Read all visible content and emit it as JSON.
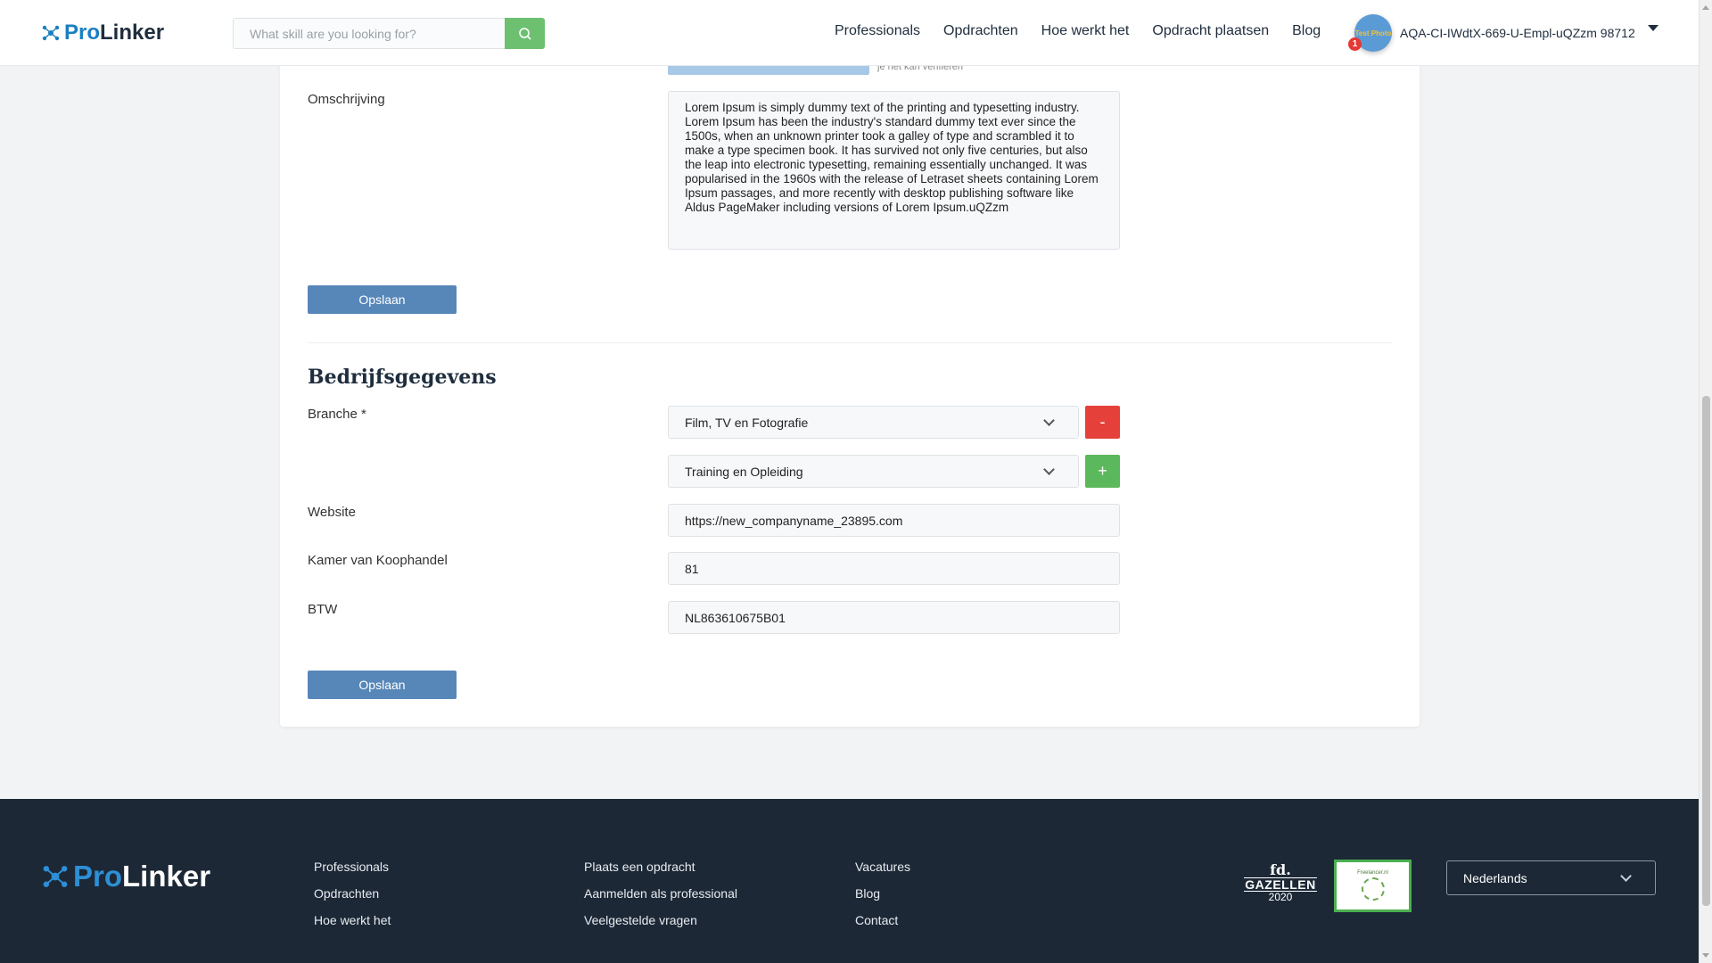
{
  "header": {
    "logo_pro": "Pro",
    "logo_linker": "Linker",
    "search_placeholder": "What skill are you looking for?",
    "nav": [
      "Professionals",
      "Opdrachten",
      "Hoe werkt het",
      "Opdracht plaatsen",
      "Blog"
    ],
    "user_name": "AQA-CI-IWdtX-669-U-Empl-uQZzm 98712",
    "notification_count": "1",
    "avatar_text": "Test Photo"
  },
  "profile": {
    "verify_note": "je het kan verifiëren",
    "description_label": "Omschrijving",
    "description_value": "Lorem Ipsum is simply dummy text of the printing and typesetting industry. Lorem Ipsum has been the industry's standard dummy text ever since the 1500s, when an unknown printer took a galley of type and scrambled it to make a type specimen book. It has survived not only five centuries, but also the leap into electronic typesetting, remaining essentially unchanged. It was popularised in the 1960s with the release of Letraset sheets containing Lorem Ipsum passages, and more recently with desktop publishing software like Aldus PageMaker including versions of Lorem Ipsum.uQZzm",
    "save_label": "Opslaan"
  },
  "company": {
    "title": "Bedrijfsgegevens",
    "branche_label": "Branche *",
    "branche_values": [
      "Film, TV en Fotografie",
      "Training en Opleiding"
    ],
    "remove_label": "-",
    "add_label": "+",
    "website_label": "Website",
    "website_value": "https://new_companyname_23895.com",
    "kvk_label": "Kamer van Koophandel",
    "kvk_value": "81",
    "btw_label": "BTW",
    "btw_value": "NL863610675B01",
    "save_label": "Opslaan"
  },
  "footer": {
    "logo_pro": "Pro",
    "logo_linker": "Linker",
    "col1": [
      "Professionals",
      "Opdrachten",
      "Hoe werkt het"
    ],
    "col2": [
      "Plaats een opdracht",
      "Aanmelden als professional",
      "Veelgestelde vragen"
    ],
    "col3": [
      "Vacatures",
      "Blog",
      "Contact"
    ],
    "badge_fd": "fd.",
    "badge_gazellen": "GAZELLEN",
    "badge_year": "2020",
    "badge_award_text": "Freelancer.nl",
    "language": "Nederlands"
  },
  "colors": {
    "brand_blue": "#1a7fc1",
    "search_button_green": "#6cc070",
    "save_button": "#5787b9",
    "remove_button": "#e5413a",
    "add_button": "#5cb85c",
    "footer_bg": "#1c2836"
  }
}
